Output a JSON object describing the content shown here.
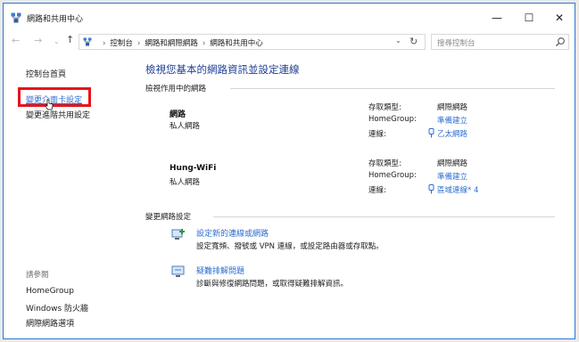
{
  "window": {
    "title": "網路和共用中心",
    "controls": {
      "minimize": "—",
      "maximize": "☐",
      "close": "✕"
    }
  },
  "nav": {
    "back": "←",
    "forward": "→",
    "recent": "⌄",
    "up": "↑",
    "breadcrumbs": [
      "控制台",
      "網路和網際網路",
      "網路和共用中心"
    ],
    "separator": "›",
    "dropdown": "⌄",
    "refresh": "↻",
    "search_placeholder": "搜尋控制台"
  },
  "sidebar": {
    "home": "控制台首頁",
    "change_adapter": "變更介面卡設定",
    "change_sharing": "變更進階共用設定",
    "see_also": "請參閱",
    "see_also_items": [
      "HomeGroup",
      "Windows 防火牆",
      "網際網路選項"
    ]
  },
  "main": {
    "title": "檢視您基本的網路資訊並設定連線",
    "active_networks_heading": "檢視作用中的網路",
    "networks": [
      {
        "name": "網路",
        "type": "私人網路",
        "access_label": "存取類型:",
        "access_value": "網際網路",
        "homegroup_label": "HomeGroup:",
        "homegroup_value": "準備建立",
        "conn_label": "連線:",
        "conn_value": "乙太網路"
      },
      {
        "name": "Hung-WiFi",
        "type": "私人網路",
        "access_label": "存取類型:",
        "access_value": "網際網路",
        "homegroup_label": "HomeGroup:",
        "homegroup_value": "準備建立",
        "conn_label": "連線:",
        "conn_value": "區域連線* 4"
      }
    ],
    "change_settings_heading": "變更網路設定",
    "tasks": [
      {
        "link": "設定新的連線或網路",
        "desc": "設定寬頻、撥號或 VPN 連線，或設定路由器或存取點。"
      },
      {
        "link": "疑難排解問題",
        "desc": "診斷與修復網路問題，或取得疑難排解資訊。"
      }
    ]
  },
  "colors": {
    "title_blue": "#1c3f94",
    "link_blue": "#2f6ed0",
    "highlight_red": "#e8141a",
    "window_border": "#2b79d0"
  }
}
